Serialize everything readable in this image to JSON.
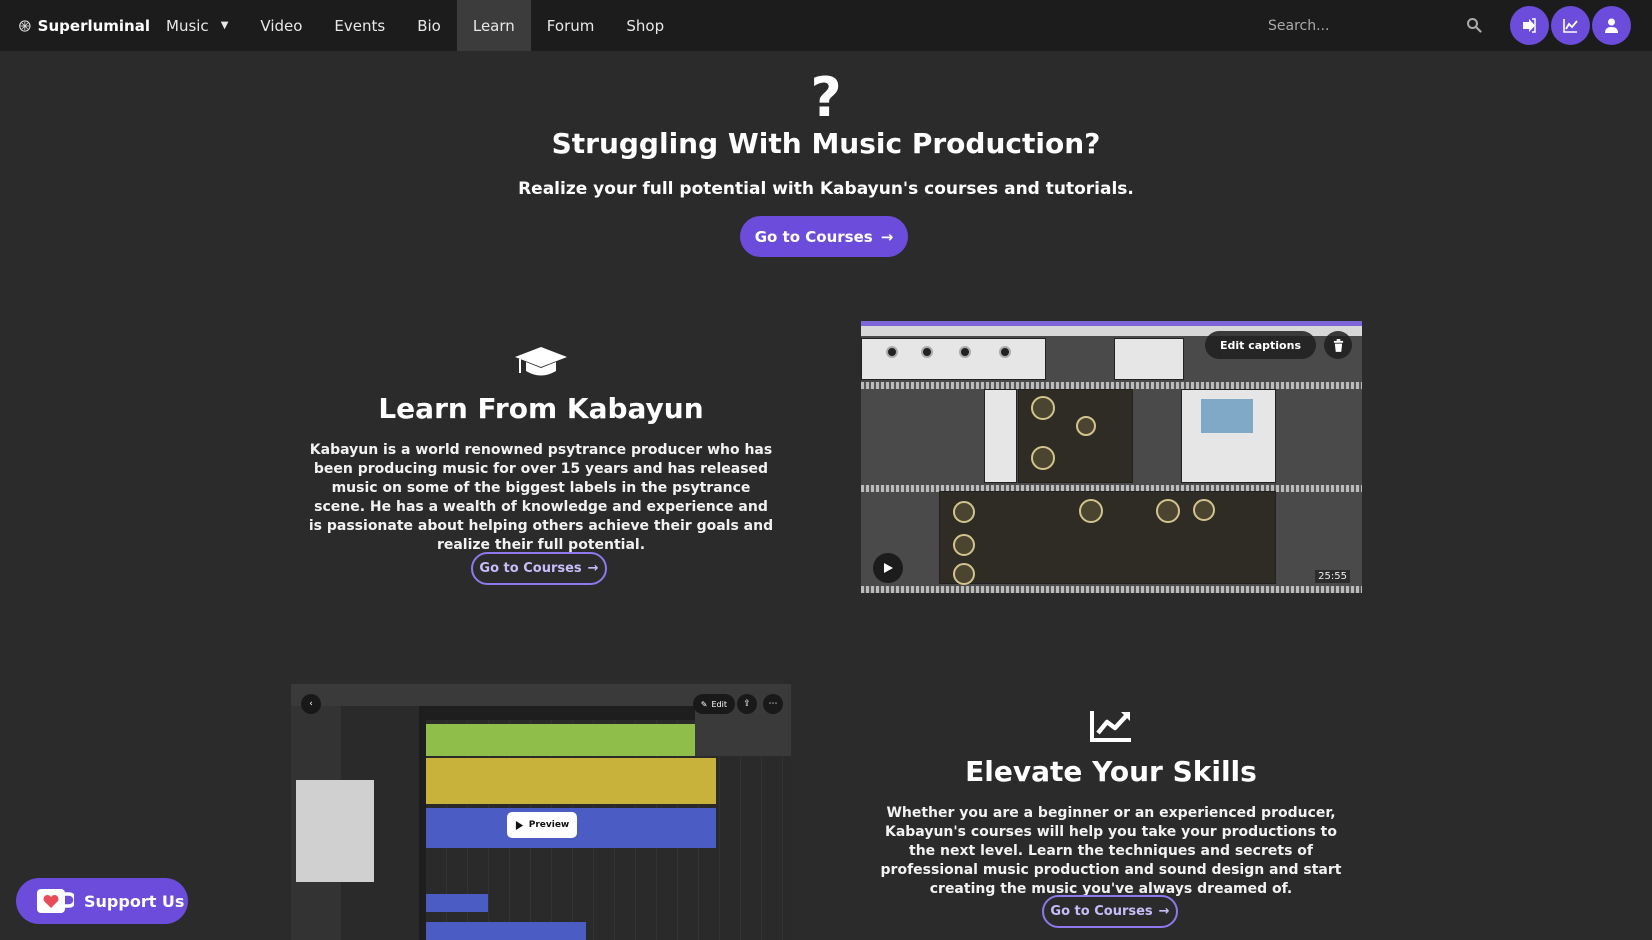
{
  "nav": {
    "brand": "Superluminal",
    "items": [
      {
        "label": "Music",
        "dropdown": true
      },
      {
        "label": "Video"
      },
      {
        "label": "Events"
      },
      {
        "label": "Bio"
      },
      {
        "label": "Learn",
        "active": true
      },
      {
        "label": "Forum"
      },
      {
        "label": "Shop"
      }
    ],
    "search_placeholder": "Search...",
    "icons": [
      "logout-icon",
      "chart-icon",
      "user-icon"
    ]
  },
  "hero": {
    "icon": "question-icon",
    "icon_glyph": "?",
    "title": "Struggling With Music Production?",
    "subtitle": "Realize your full potential with Kabayun's courses and tutorials.",
    "button": "Go to Courses"
  },
  "learn": {
    "icon": "graduation-cap-icon",
    "title": "Learn From Kabayun",
    "text": "Kabayun is a world renowned psytrance producer who has been producing music for over 15 years and has released music on some of the biggest labels in the psytrance scene. He has a wealth of knowledge and experience and is passionate about helping others achieve their goals and realize their full potential.",
    "button": "Go to Courses",
    "video": {
      "edit_captions": "Edit captions",
      "duration": "25:55"
    }
  },
  "elevate": {
    "icon": "chart-line-icon",
    "title": "Elevate Your Skills",
    "text": "Whether you are a beginner or an experienced producer, Kabayun's courses will help you take your productions to the next level. Learn the techniques and secrets of professional music production and sound design and start creating the music you've always dreamed of.",
    "button": "Go to Courses",
    "video": {
      "preview": "Preview",
      "edit": "Edit"
    }
  },
  "support": {
    "label": "Support Us"
  },
  "colors": {
    "accent": "#6c4cdb",
    "navbar": "#1c1c1c",
    "background": "#2b2b2b",
    "outline": "#8f78ee"
  }
}
